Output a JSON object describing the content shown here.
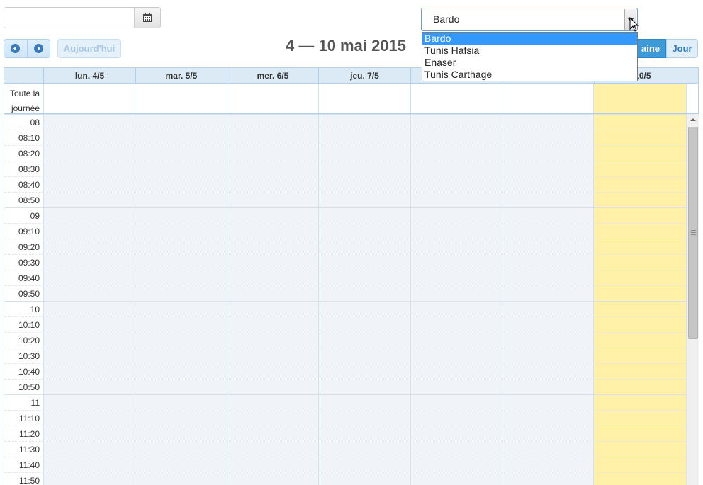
{
  "toolbar": {
    "date_value": "",
    "location_selected": "Bardo",
    "location_options": [
      "Bardo",
      "Tunis Hafsia",
      "Enaser",
      "Tunis Carthage"
    ],
    "today_label": "Aujourd'hui",
    "title": "4 — 10 mai 2015",
    "view_week_label": "aine",
    "view_day_label": "Jour",
    "accent_color": "#3d9ad6"
  },
  "calendar": {
    "days": [
      "lun. 4/5",
      "mar. 5/5",
      "mer. 6/5",
      "jeu. 7/5",
      "",
      "",
      ". 10/5"
    ],
    "allday_label": "Toute la journée",
    "time_slots": [
      "08",
      "08:10",
      "08:20",
      "08:30",
      "08:40",
      "08:50",
      "09",
      "09:10",
      "09:20",
      "09:30",
      "09:40",
      "09:50",
      "10",
      "10:10",
      "10:20",
      "10:30",
      "10:40",
      "10:50",
      "11",
      "11:10",
      "11:20",
      "11:30",
      "11:40",
      "11:50"
    ],
    "today_color": "#fff1a8"
  }
}
